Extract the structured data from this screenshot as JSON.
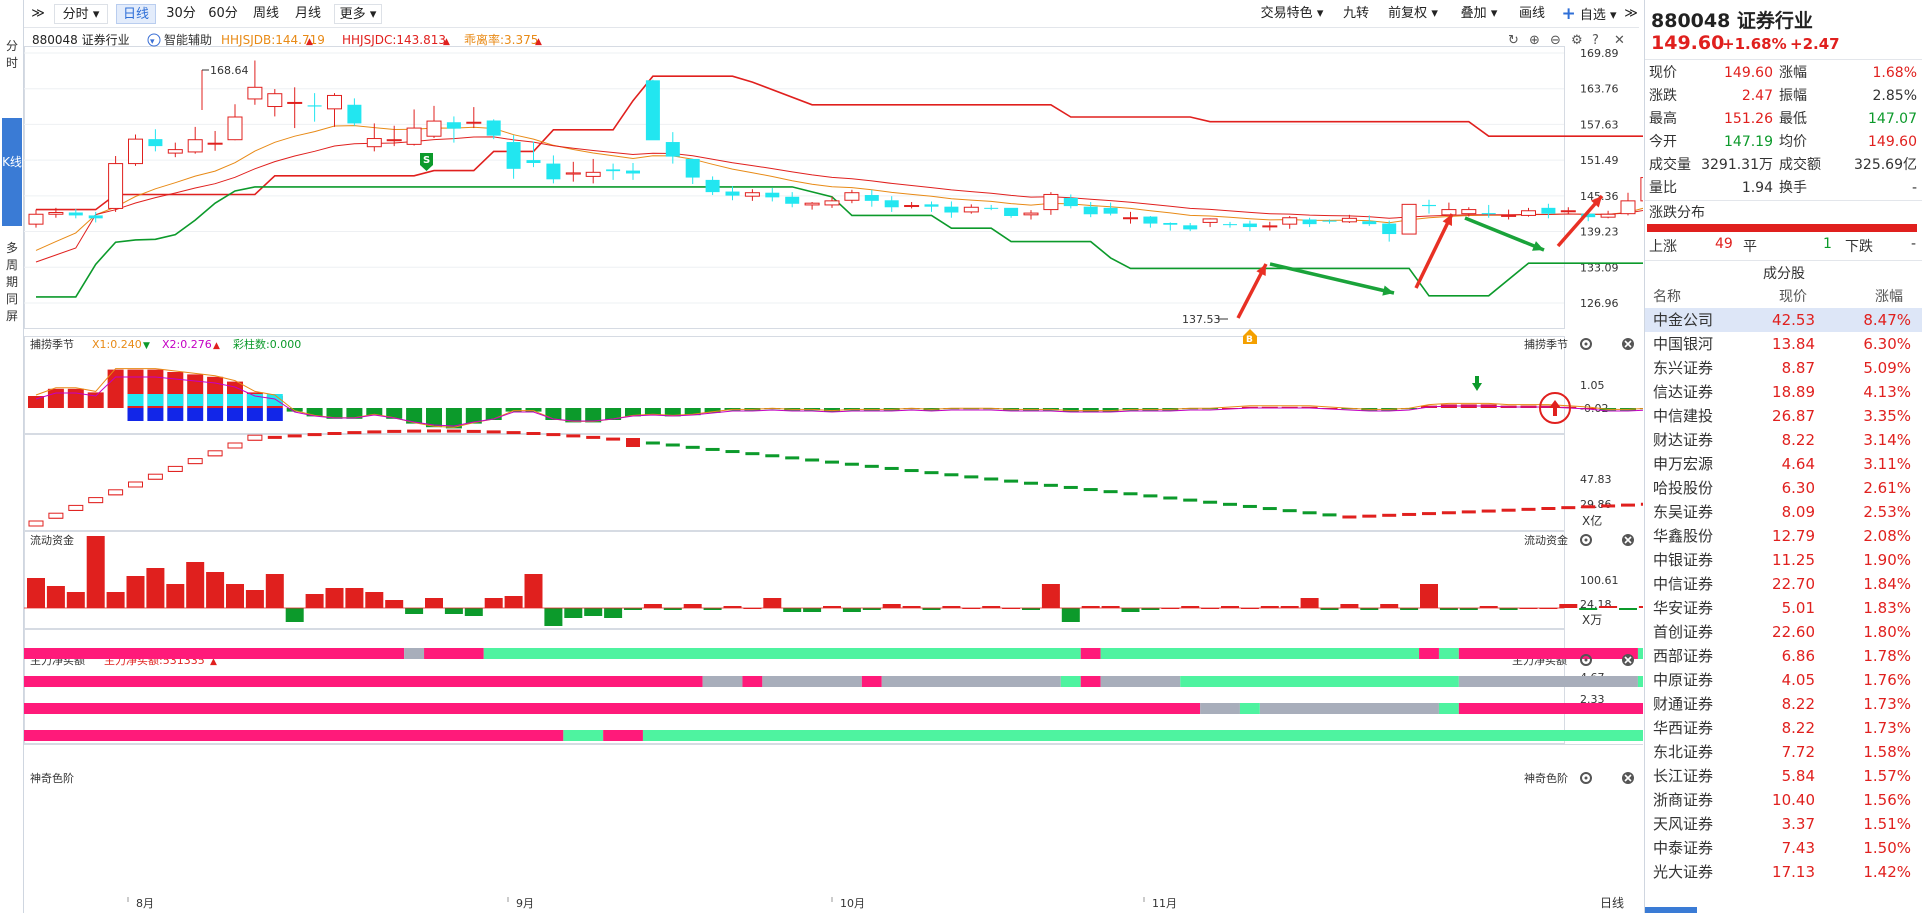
{
  "toolbar": {
    "collapse_left_label": "≫",
    "period_menu": "分时",
    "periods": [
      "日线",
      "30分",
      "60分",
      "周线",
      "月线"
    ],
    "more_label": "更多",
    "right_items": [
      "交易特色",
      "九转",
      "前复权",
      "叠加",
      "画线"
    ],
    "favorite_label": "自选",
    "collapse_right_label": "≫"
  },
  "leftbar": {
    "items": [
      "分时",
      "K线",
      "多周期同屏"
    ]
  },
  "header": {
    "code_name": "880048 证券行业",
    "assist_label": "智能辅助",
    "ind1": "HHJSJDB:144.719",
    "ind2": "HHJSJDC:143.813",
    "ind3": "乖离率:3.375"
  },
  "colors": {
    "up": "#e0201e",
    "down": "#0c9a2b",
    "cyan": "#22e6f0",
    "magenta": "#ff1a7a",
    "mint": "#4ef3a0",
    "gray": "#a8aebb",
    "blue": "#1226e8"
  },
  "main_chart": {
    "y_ticks": [
      "169.89",
      "163.76",
      "157.63",
      "151.49",
      "145.36",
      "139.23",
      "133.09",
      "126.96"
    ],
    "high_label": "168.64",
    "low_label": "137.53",
    "buy_marker": "B",
    "sell_marker": "S",
    "x_labels": [
      "8月",
      "9月",
      "10月",
      "11月"
    ],
    "period_label": "日线"
  },
  "panel1": {
    "title": "捕捞季节",
    "x1": "X1:0.240",
    "x2": "X2:0.276",
    "bar": "彩柱数:0.000",
    "right_title": "捕捞季节",
    "y_ticks": [
      "1.05",
      "-0.02"
    ]
  },
  "panel2": {
    "title": "流动资金",
    "right_title": "流动资金",
    "y_ticks": [
      "47.83",
      "29.86"
    ],
    "unit": "X亿"
  },
  "panel3": {
    "title": "主力净买额",
    "value": "主力净买额:531335",
    "right_title": "主力净买额",
    "y_ticks": [
      "100.61",
      "24.18"
    ],
    "unit": "X万"
  },
  "panel4": {
    "title": "神奇色阶",
    "right_title": "神奇色阶",
    "y_ticks": [
      "4.67",
      "2.33"
    ]
  },
  "quote": {
    "title": "880048 证券行业",
    "price": "149.60",
    "change_pct": "+1.68%",
    "change": "+2.47",
    "rows": [
      {
        "l1": "现价",
        "v1": "149.60",
        "l2": "涨幅",
        "v2": "1.68%",
        "c1": "up",
        "c2": "up"
      },
      {
        "l1": "涨跌",
        "v1": "2.47",
        "l2": "振幅",
        "v2": "2.85%",
        "c1": "up",
        "c2": "plain"
      },
      {
        "l1": "最高",
        "v1": "151.26",
        "l2": "最低",
        "v2": "147.07",
        "c1": "up",
        "c2": "dn"
      },
      {
        "l1": "今开",
        "v1": "147.19",
        "l2": "均价",
        "v2": "149.60",
        "c1": "dn",
        "c2": "up"
      },
      {
        "l1": "成交量",
        "v1": "3291.31万",
        "l2": "成交额",
        "v2": "325.69亿",
        "c1": "plain",
        "c2": "plain"
      },
      {
        "l1": "量比",
        "v1": "1.94",
        "l2": "换手",
        "v2": "-",
        "c1": "plain",
        "c2": "plain"
      }
    ],
    "dist_title": "涨跌分布",
    "dist_up_label": "上涨",
    "dist_up": "49",
    "dist_flat_label": "平",
    "dist_flat": "1",
    "dist_down_label": "下跌",
    "dist_down": "-",
    "components_title": "成分股",
    "col_name": "名称",
    "col_price": "现价",
    "col_change": "涨幅"
  },
  "stocks": [
    {
      "name": "中金公司",
      "price": "42.53",
      "change": "8.47%"
    },
    {
      "name": "中国银河",
      "price": "13.84",
      "change": "6.30%"
    },
    {
      "name": "东兴证券",
      "price": "8.87",
      "change": "5.09%"
    },
    {
      "name": "信达证券",
      "price": "18.89",
      "change": "4.13%"
    },
    {
      "name": "中信建投",
      "price": "26.87",
      "change": "3.35%"
    },
    {
      "name": "财达证券",
      "price": "8.22",
      "change": "3.14%"
    },
    {
      "name": "申万宏源",
      "price": "4.64",
      "change": "3.11%"
    },
    {
      "name": "哈投股份",
      "price": "6.30",
      "change": "2.61%"
    },
    {
      "name": "东吴证券",
      "price": "8.09",
      "change": "2.53%"
    },
    {
      "name": "华鑫股份",
      "price": "12.79",
      "change": "2.08%"
    },
    {
      "name": "中银证券",
      "price": "11.25",
      "change": "1.90%"
    },
    {
      "name": "中信证券",
      "price": "22.70",
      "change": "1.84%"
    },
    {
      "name": "华安证券",
      "price": "5.01",
      "change": "1.83%"
    },
    {
      "name": "首创证券",
      "price": "22.60",
      "change": "1.80%"
    },
    {
      "name": "西部证券",
      "price": "6.86",
      "change": "1.78%"
    },
    {
      "name": "中原证券",
      "price": "4.05",
      "change": "1.76%"
    },
    {
      "name": "财通证券",
      "price": "8.22",
      "change": "1.73%"
    },
    {
      "name": "华西证券",
      "price": "8.22",
      "change": "1.73%"
    },
    {
      "name": "东北证券",
      "price": "7.72",
      "change": "1.58%"
    },
    {
      "name": "长江证券",
      "price": "5.84",
      "change": "1.57%"
    },
    {
      "name": "浙商证券",
      "price": "10.40",
      "change": "1.56%"
    },
    {
      "name": "天风证券",
      "price": "3.37",
      "change": "1.51%"
    },
    {
      "name": "中泰证券",
      "price": "7.43",
      "change": "1.50%"
    },
    {
      "name": "光大证券",
      "price": "17.13",
      "change": "1.42%"
    }
  ],
  "candles": [
    [
      140.5,
      142.2,
      143.0,
      139.9
    ],
    [
      142.2,
      142.5,
      143.3,
      141.6
    ],
    [
      142.5,
      142.0,
      143.1,
      141.5
    ],
    [
      142.0,
      141.5,
      142.6,
      140.8
    ],
    [
      143.2,
      150.9,
      152.2,
      142.6
    ],
    [
      150.9,
      155.1,
      155.9,
      150.5
    ],
    [
      155.1,
      153.9,
      156.8,
      153.0
    ],
    [
      152.7,
      153.3,
      154.5,
      152.0
    ],
    [
      152.9,
      155.0,
      157.2,
      152.6
    ],
    [
      154.4,
      154.4,
      156.5,
      153.1
    ],
    [
      155.0,
      158.9,
      161.1,
      154.9
    ],
    [
      162.0,
      164.0,
      168.6,
      161.0
    ],
    [
      160.7,
      162.9,
      163.7,
      159.0
    ],
    [
      161.4,
      161.4,
      164.0,
      157.0
    ],
    [
      160.9,
      160.7,
      163.0,
      158.1
    ],
    [
      160.3,
      162.6,
      163.0,
      157.2
    ],
    [
      161.0,
      157.8,
      162.1,
      157.4
    ],
    [
      153.8,
      155.2,
      157.8,
      153.0
    ],
    [
      154.9,
      155.0,
      157.4,
      153.9
    ],
    [
      154.2,
      157.0,
      160.2,
      154.0
    ],
    [
      155.6,
      158.2,
      160.8,
      155.3
    ],
    [
      158.0,
      156.9,
      159.0,
      154.5
    ],
    [
      158.0,
      158.0,
      160.6,
      157.0
    ],
    [
      158.3,
      155.7,
      158.5,
      155.1
    ],
    [
      154.6,
      150.0,
      155.8,
      148.3
    ],
    [
      151.5,
      151.0,
      154.7,
      150.3
    ],
    [
      150.9,
      148.2,
      152.3,
      147.5
    ],
    [
      149.1,
      149.3,
      151.2,
      147.8
    ],
    [
      148.7,
      149.4,
      151.7,
      147.5
    ],
    [
      149.9,
      149.6,
      150.9,
      148.1
    ],
    [
      149.7,
      149.2,
      151.0,
      148.1
    ],
    [
      165.2,
      154.9,
      165.3,
      155.0
    ],
    [
      154.6,
      152.1,
      156.3,
      150.9
    ],
    [
      151.7,
      148.5,
      151.6,
      147.4
    ],
    [
      148.1,
      146.0,
      148.7,
      145.5
    ],
    [
      146.1,
      145.4,
      147.0,
      144.6
    ],
    [
      145.3,
      145.9,
      146.5,
      144.5
    ],
    [
      145.9,
      145.1,
      146.7,
      144.4
    ],
    [
      145.2,
      144.0,
      146.0,
      143.4
    ],
    [
      143.8,
      144.1,
      144.3,
      143.0
    ],
    [
      143.8,
      144.5,
      145.2,
      143.3
    ],
    [
      144.6,
      145.9,
      146.4,
      144.1
    ],
    [
      145.5,
      144.5,
      146.4,
      143.5
    ],
    [
      144.6,
      143.4,
      145.3,
      142.6
    ],
    [
      143.6,
      143.7,
      144.3,
      143.2
    ],
    [
      143.9,
      143.5,
      144.4,
      142.6
    ],
    [
      143.5,
      142.5,
      144.4,
      141.6
    ],
    [
      142.6,
      143.4,
      143.9,
      142.3
    ],
    [
      143.3,
      143.2,
      143.8,
      142.9
    ],
    [
      143.3,
      141.9,
      143.2,
      141.6
    ],
    [
      142.1,
      142.4,
      142.9,
      141.3
    ],
    [
      143.0,
      145.6,
      146.0,
      142.1
    ],
    [
      145.0,
      143.6,
      145.6,
      143.2
    ],
    [
      143.5,
      142.2,
      144.3,
      141.7
    ],
    [
      143.3,
      142.3,
      144.2,
      142.0
    ],
    [
      141.6,
      141.6,
      142.6,
      140.6
    ],
    [
      141.8,
      140.6,
      141.9,
      139.9
    ],
    [
      140.7,
      140.4,
      140.8,
      139.4
    ],
    [
      140.3,
      139.6,
      140.7,
      139.3
    ],
    [
      140.8,
      141.4,
      141.5,
      140.0
    ],
    [
      140.5,
      140.4,
      140.9,
      139.9
    ],
    [
      140.6,
      140.0,
      141.1,
      139.3
    ],
    [
      140.2,
      140.2,
      140.9,
      139.4
    ],
    [
      140.5,
      141.6,
      141.9,
      139.7
    ],
    [
      141.3,
      140.5,
      141.6,
      140.0
    ],
    [
      141.1,
      141.0,
      141.3,
      140.6
    ],
    [
      140.9,
      141.5,
      142.1,
      140.7
    ],
    [
      141.0,
      140.5,
      142.0,
      140.2
    ],
    [
      140.6,
      138.8,
      141.1,
      137.5
    ],
    [
      138.8,
      143.9,
      143.9,
      138.8
    ],
    [
      143.8,
      143.6,
      144.7,
      142.3
    ],
    [
      142.1,
      143.0,
      144.2,
      142.0
    ],
    [
      142.3,
      143.0,
      143.4,
      141.8
    ],
    [
      142.4,
      142.2,
      143.8,
      141.6
    ],
    [
      142.0,
      142.0,
      143.0,
      141.3
    ],
    [
      142.0,
      142.8,
      143.3,
      141.8
    ],
    [
      143.3,
      142.3,
      144.0,
      141.5
    ],
    [
      142.7,
      142.8,
      143.4,
      142.3
    ],
    [
      142.3,
      141.7,
      142.7,
      141.0
    ],
    [
      141.7,
      142.2,
      142.8,
      141.5
    ],
    [
      142.3,
      144.5,
      145.9,
      142.0
    ],
    [
      144.5,
      148.5,
      149.6,
      143.8
    ],
    [
      148.5,
      149.6,
      150.5,
      147.3
    ],
    [
      149.4,
      149.0,
      150.2,
      147.5
    ],
    [
      148.3,
      148.8,
      149.6,
      147.8
    ],
    [
      148.1,
      147.4,
      148.8,
      147.1
    ],
    [
      147.5,
      148.2,
      148.9,
      147.1
    ],
    [
      148.5,
      147.4,
      148.7,
      147.0
    ],
    [
      147.1,
      149.6,
      151.3,
      147.1
    ]
  ],
  "band_upper": [
    [
      0,
      143.0
    ],
    [
      3,
      143.0
    ],
    [
      4,
      145.6
    ],
    [
      11,
      145.6
    ],
    [
      12,
      148.8
    ],
    [
      19,
      148.8
    ],
    [
      20,
      149.7
    ],
    [
      22,
      149.7
    ],
    [
      23,
      153.0
    ],
    [
      25,
      153.0
    ],
    [
      26,
      156.7
    ],
    [
      29,
      156.7
    ],
    [
      30,
      161.7
    ],
    [
      31,
      165.9
    ],
    [
      35,
      165.9
    ],
    [
      36,
      164.9
    ],
    [
      39,
      161.0
    ],
    [
      51,
      161.0
    ],
    [
      52,
      158.9
    ],
    [
      58,
      158.9
    ],
    [
      59,
      158.1
    ],
    [
      72,
      158.1
    ],
    [
      73,
      155.6
    ],
    [
      91,
      155.6
    ]
  ],
  "band_lower": [
    [
      0,
      128.0
    ],
    [
      2,
      128.0
    ],
    [
      3,
      133.6
    ],
    [
      4,
      137.4
    ],
    [
      5,
      137.8
    ],
    [
      6,
      137.9
    ],
    [
      7,
      138.7
    ],
    [
      8,
      141.2
    ],
    [
      9,
      144.1
    ],
    [
      10,
      146.2
    ],
    [
      11,
      146.9
    ],
    [
      18,
      146.9
    ],
    [
      19,
      146.9
    ],
    [
      31,
      146.9
    ],
    [
      32,
      146.9
    ],
    [
      35,
      146.9
    ],
    [
      36,
      146.9
    ],
    [
      38,
      146.9
    ],
    [
      40,
      145.2
    ],
    [
      41,
      142.0
    ],
    [
      42,
      142.0
    ],
    [
      45,
      142.0
    ],
    [
      46,
      139.8
    ],
    [
      48,
      139.8
    ],
    [
      49,
      137.5
    ],
    [
      53,
      137.5
    ],
    [
      54,
      134.7
    ],
    [
      55,
      132.9
    ],
    [
      59,
      132.9
    ],
    [
      69,
      132.9
    ],
    [
      70,
      128.2
    ],
    [
      71,
      128.2
    ],
    [
      73,
      128.2
    ],
    [
      75,
      133.8
    ],
    [
      91,
      133.8
    ]
  ]
}
